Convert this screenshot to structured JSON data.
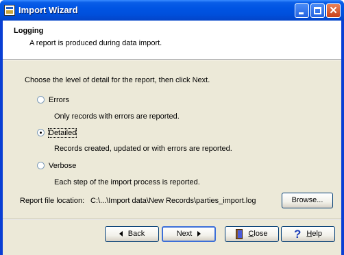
{
  "window": {
    "title": "Import Wizard"
  },
  "header": {
    "title": "Logging",
    "subtitle": "A report is produced during data import."
  },
  "instruction": "Choose the level of detail for the report, then click Next.",
  "options": [
    {
      "label": "Errors",
      "description": "Only records with errors are reported.",
      "selected": false
    },
    {
      "label": "Detailed",
      "description": "Records created, updated or with errors are reported.",
      "selected": true
    },
    {
      "label": "Verbose",
      "description": "Each step of the import process is reported.",
      "selected": false
    }
  ],
  "report": {
    "label": "Report file location:",
    "path": "C:\\...\\Import data\\New Records\\parties_import.log",
    "browse_label": "Browse..."
  },
  "buttons": {
    "back": "Back",
    "next": "Next",
    "close_prefix": "C",
    "close_rest": "lose",
    "help_prefix": "H",
    "help_rest": "elp"
  },
  "icons": {
    "app": "import-wizard-icon",
    "back": "arrow-left-icon",
    "next": "arrow-right-icon",
    "close": "door-exit-icon",
    "help": "question-mark-icon"
  }
}
